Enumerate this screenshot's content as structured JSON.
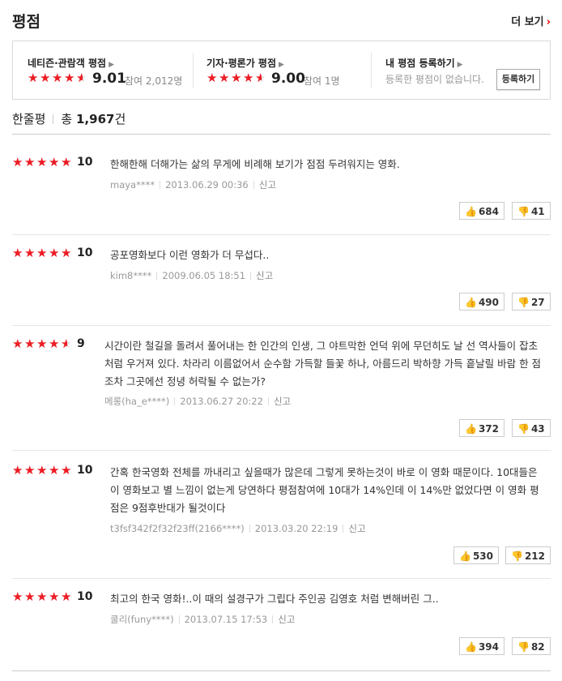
{
  "header": {
    "title": "평점",
    "more_label": "더 보기"
  },
  "summary": {
    "netizen": {
      "label": "네티즌·관람객 평점",
      "score": "9.01",
      "participants_label": "참여",
      "participants": "2,012명",
      "stars": 4.5
    },
    "critic": {
      "label": "기자·평론가 평점",
      "score": "9.00",
      "participants_label": "참여",
      "participants": "1명",
      "stars": 4.5
    },
    "mine": {
      "label": "내 평점 등록하기",
      "sub": "등록한 평점이 없습니다.",
      "button": "등록하기"
    }
  },
  "oneline": {
    "title": "한줄평",
    "total_label": "총",
    "count": "1,967",
    "unit": "건"
  },
  "reviews": [
    {
      "stars": 5,
      "score": "10",
      "text": "한해한해 더해가는 삶의 무게에 비례해 보기가 점점 두려워지는 영화.",
      "author": "maya****",
      "date": "2013.06.29 00:36",
      "report": "신고",
      "likes": "684",
      "dislikes": "41"
    },
    {
      "stars": 5,
      "score": "10",
      "text": "공포영화보다 이런 영화가 더 무섭다..",
      "author": "kim8****",
      "date": "2009.06.05 18:51",
      "report": "신고",
      "likes": "490",
      "dislikes": "27"
    },
    {
      "stars": 4.5,
      "score": "9",
      "text": "시간이란 철길을 돌려서 풀어내는 한 인간의 인생, 그 야트막한 언덕 위에 무던히도 날 선 역사들이 잡초처럼 우거져 있다. 차라리 이름없어서 순수함 가득할 들꽃 하나, 아름드리 박하향 가득 흩날릴 바람 한 점조차 그곳에선 정녕 허락될 수 없는가?",
      "author": "메롱(ha_e****)",
      "date": "2013.06.27 20:22",
      "report": "신고",
      "likes": "372",
      "dislikes": "43"
    },
    {
      "stars": 5,
      "score": "10",
      "text": "간혹 한국영화 전체를 까내리고 싶을때가 많은데 그렇게 못하는것이 바로 이 영화 때문이다. 10대들은 이 영화보고 별 느낌이 없는게 당연하다 평점참여에 10대가 14%인데 이 14%만 없었다면 이 영화 평점은 9점후반대가 될것이다",
      "author": "t3fsf342f2f32f23ff(2166****)",
      "date": "2013.03.20 22:19",
      "report": "신고",
      "likes": "530",
      "dislikes": "212"
    },
    {
      "stars": 5,
      "score": "10",
      "text": "최고의 한국 영화!..이 때의 설경구가 그립다 주인공 김영호 처럼 변해버린 그..",
      "author": "쿨리(funy****)",
      "date": "2013.07.15 17:53",
      "report": "신고",
      "likes": "394",
      "dislikes": "82"
    }
  ],
  "icons": {
    "star": "star-icon",
    "like": "thumbs-up-icon",
    "dislike": "thumbs-down-icon",
    "more": "chevron-right-icon"
  },
  "colors": {
    "star": "#ed1c24",
    "accent": "#e50000"
  }
}
